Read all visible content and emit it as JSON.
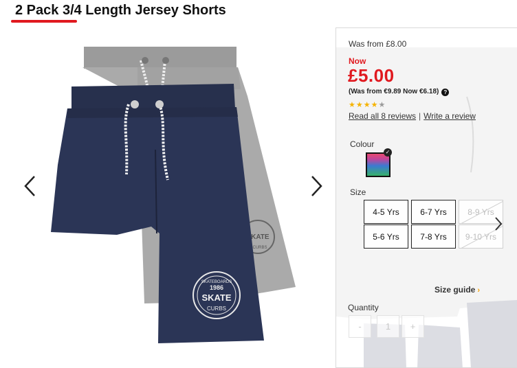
{
  "product": {
    "title": "2 Pack 3/4 Length Jersey Shorts"
  },
  "gallery": {
    "prev_icon": "chevron-left-icon",
    "next_icon": "chevron-right-icon",
    "front_shorts": {
      "badge_top": "SKATEBOARDS",
      "badge_year": "1986",
      "badge_main": "SKATE",
      "badge_sub": "CURBS",
      "color": "#2b3556"
    },
    "back_shorts": {
      "badge_main": "SKATE",
      "badge_sub": "CURBS",
      "color": "#a9a9a9"
    }
  },
  "pricing": {
    "was": "Was from £8.00",
    "now_label": "Now",
    "price": "£5.00",
    "euro": "(Was from €9.89 Now €6.18)",
    "help_icon": "?",
    "accent_color": "#e0191f"
  },
  "rating": {
    "stars_filled": 4,
    "stars_total": 5,
    "star_char": "★",
    "read_reviews": "Read all 8 reviews",
    "separator": "|",
    "write_review": "Write a review"
  },
  "colour": {
    "label": "Colour",
    "check_icon": "✓"
  },
  "size": {
    "label": "Size",
    "options": [
      {
        "label": "4-5 Yrs",
        "available": true
      },
      {
        "label": "6-7 Yrs",
        "available": true
      },
      {
        "label": "8-9 Yrs",
        "available": false
      },
      {
        "label": "5-6 Yrs",
        "available": true
      },
      {
        "label": "7-8 Yrs",
        "available": true
      },
      {
        "label": "9-10 Yrs",
        "available": false
      }
    ],
    "next_icon": "chevron-right-icon"
  },
  "size_guide": {
    "label": "Size guide",
    "chevron": "›"
  },
  "quantity": {
    "label": "Quantity",
    "minus": "-",
    "value": "1",
    "plus": "+"
  }
}
